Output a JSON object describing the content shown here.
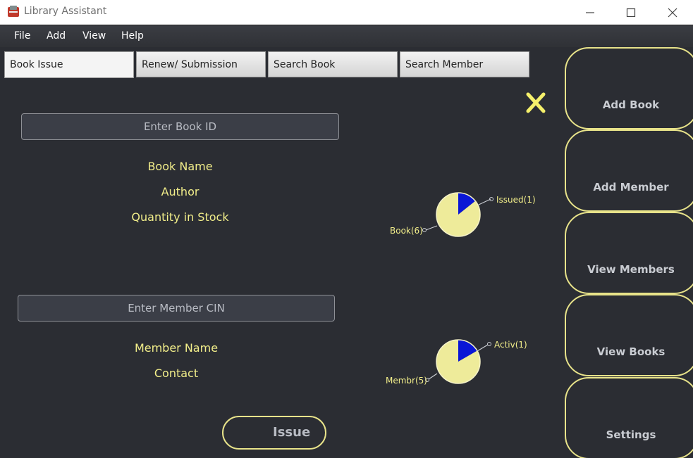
{
  "window": {
    "title": "Library Assistant"
  },
  "menu": [
    "File",
    "Add",
    "View",
    "Help"
  ],
  "tabs": [
    "Book Issue",
    "Renew/ Submission",
    "Search Book",
    "Search Member"
  ],
  "book_section": {
    "book_id_placeholder": "Enter Book ID",
    "book_name": "Book Name",
    "author": "Author",
    "quantity": "Quantity in Stock"
  },
  "member_section": {
    "member_cin_placeholder": "Enter Member CIN",
    "member_name": "Member Name",
    "contact": "Contact"
  },
  "issue_label": "Issue",
  "side_buttons": [
    "Add Book",
    "Add Member",
    "View Members",
    "View Books",
    "Settings"
  ],
  "charts": {
    "book_pie": {
      "slices": [
        {
          "label": "Issued(1)",
          "value": 1,
          "color": "#0a16d6"
        },
        {
          "label": "Book(6)",
          "value": 6,
          "color": "#eeeb9a"
        }
      ]
    },
    "member_pie": {
      "slices": [
        {
          "label": "Activ(1)",
          "value": 1,
          "color": "#0a16d6"
        },
        {
          "label": "Membr(5)",
          "value": 5,
          "color": "#eeeb9a"
        }
      ]
    }
  },
  "colors": {
    "background": "#2b2d33",
    "accent_yellow": "#e8e38a",
    "text_yellow": "#f2ee8a",
    "pie_highlight": "#0a16d6",
    "close_x": "#f5f06b"
  }
}
